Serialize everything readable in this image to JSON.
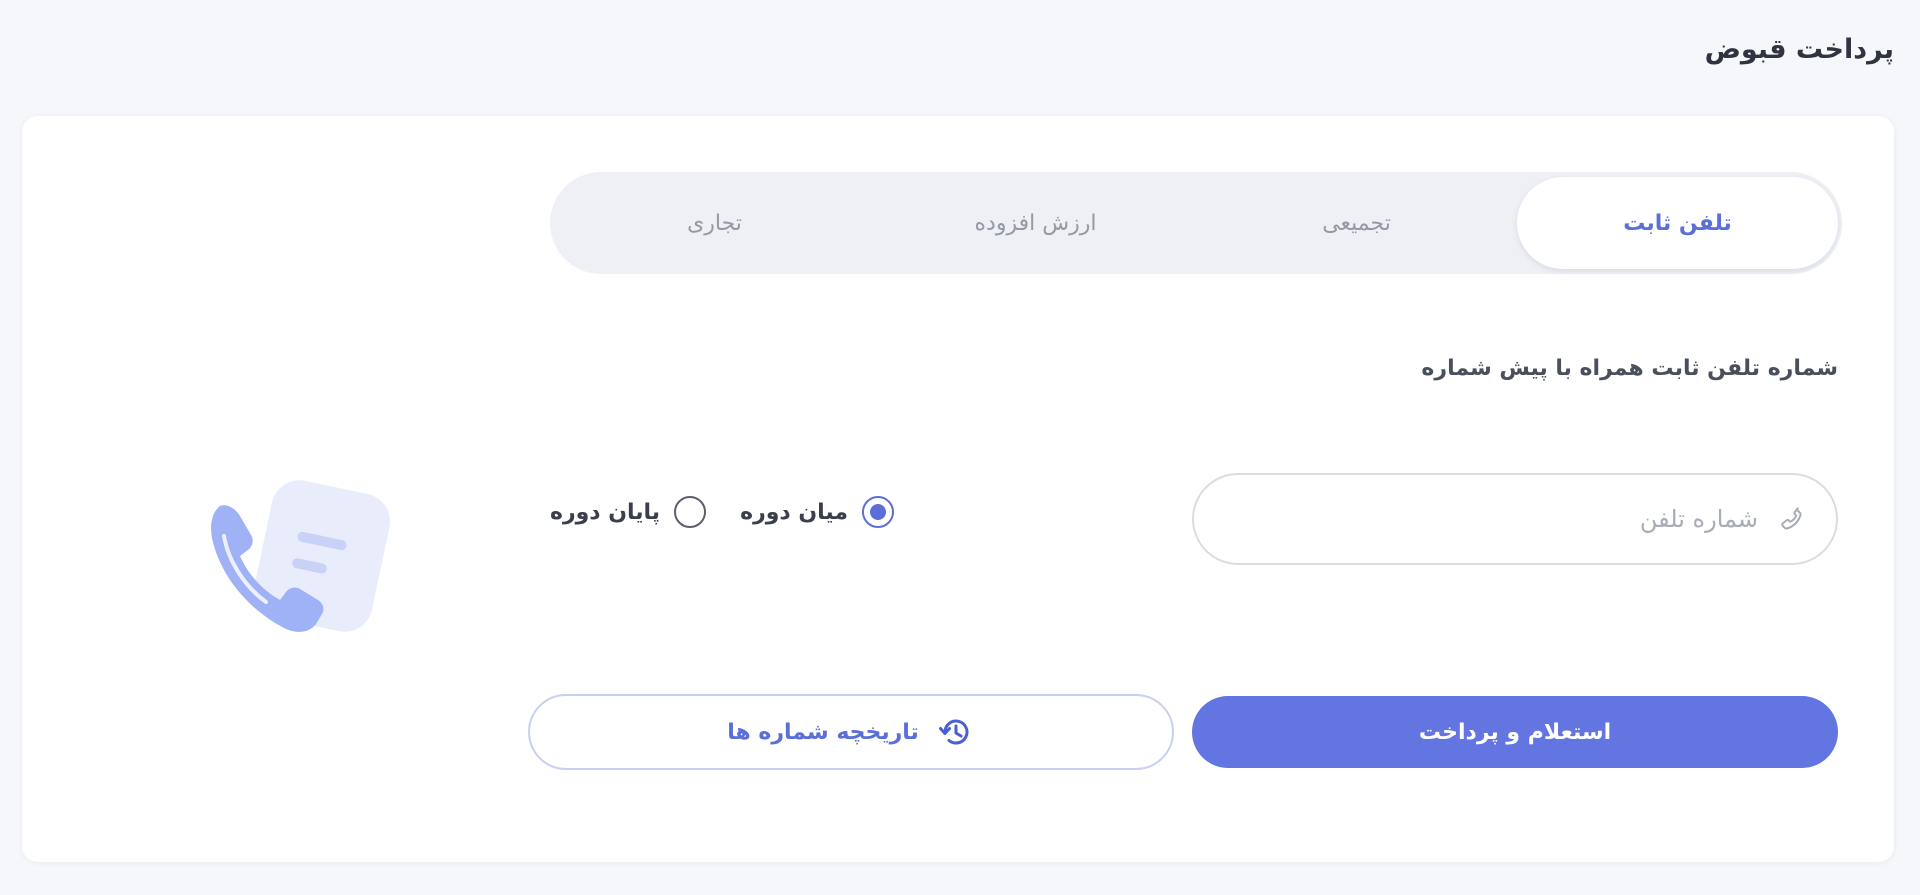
{
  "page": {
    "title": "پرداخت قبوض"
  },
  "tabs": [
    {
      "label": "تلفن ثابت",
      "active": true
    },
    {
      "label": "تجمیعی",
      "active": false
    },
    {
      "label": "ارزش افزوده",
      "active": false
    },
    {
      "label": "تجاری",
      "active": false
    }
  ],
  "form": {
    "field_label": "شماره تلفن ثابت همراه با پیش شماره",
    "phone_placeholder": "شماره تلفن",
    "phone_value": "",
    "radios": [
      {
        "label": "میان دوره",
        "checked": true
      },
      {
        "label": "پایان دوره",
        "checked": false
      }
    ]
  },
  "buttons": {
    "submit_label": "استعلام و پرداخت",
    "history_label": "تاریخچه شماره ها"
  },
  "icons": {
    "input": "phone-icon",
    "history": "history-icon",
    "illustration": "phone-bill-illustration"
  },
  "colors": {
    "accent": "#6275e0",
    "active_tab_text": "#5b6fd8",
    "illustration_phone": "#9fb2f6",
    "illustration_paper": "#e8ecfb"
  }
}
